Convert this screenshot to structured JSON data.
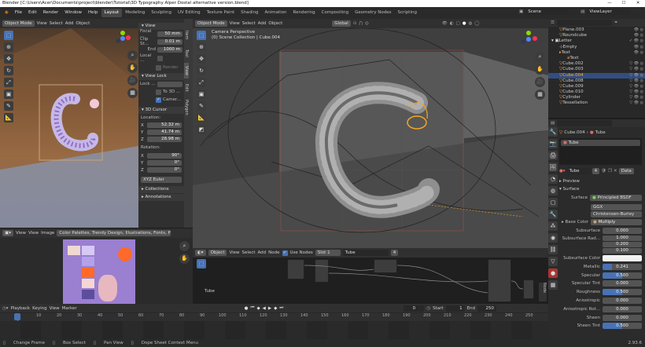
{
  "title": "Blender [C:\\Users\\Acer\\Documents\\project\\blender\\Tutorial\\3D Typography Alper Dostal alternative version.blend]",
  "window_controls": [
    "—",
    "☐",
    "✕"
  ],
  "menu": [
    "File",
    "Edit",
    "Render",
    "Window",
    "Help"
  ],
  "workspaces": [
    "Layout",
    "Modeling",
    "Sculpting",
    "UV Editing",
    "Texture Paint",
    "Shading",
    "Animation",
    "Rendering",
    "Compositing",
    "Geometry Nodes",
    "Scripting"
  ],
  "active_workspace": "Layout",
  "scene": "Scene",
  "view_layer": "ViewLayer",
  "left_viewport": {
    "mode": "Object Mode",
    "menus": [
      "View",
      "Select",
      "Add",
      "Object"
    ]
  },
  "n_panel": {
    "view_title": "View",
    "focal_label": "Focal ...",
    "focal_value": "50 mm",
    "clip_label": "Clip St...",
    "clip_value": "0.01 m",
    "end_label": "End",
    "end_value": "1000 m",
    "local_label": "Local ...",
    "render_label": "Render",
    "view_lock_title": "View Lock",
    "lock_label": "Lock ...",
    "lock_to_label": "To 3D ...",
    "camera_label": "Camer...",
    "cursor_title": "3D Cursor",
    "location_label": "Location:",
    "loc": [
      {
        "a": "X",
        "v": "52.32 m"
      },
      {
        "a": "Y",
        "v": "41.74 m"
      },
      {
        "a": "Z",
        "v": "28.98 m"
      }
    ],
    "rotation_label": "Rotation:",
    "rot": [
      {
        "a": "X",
        "v": "90°"
      },
      {
        "a": "Y",
        "v": "0°"
      },
      {
        "a": "Z",
        "v": "0°"
      }
    ],
    "rot_mode": "XYZ Euler",
    "collections_title": "Collections",
    "annotations_title": "Annotations",
    "tabs": [
      "Item",
      "Tool",
      "View",
      "Edit",
      "Polygon"
    ]
  },
  "main_viewport": {
    "mode": "Object Mode",
    "menus": [
      "View",
      "Select",
      "Add",
      "Object"
    ],
    "camera_label": "Camera Perspective",
    "collection_label": "(0) Scene Collection | Cube.004",
    "transform": "Global"
  },
  "image_editor": {
    "menus": [
      "View",
      "View",
      "Image"
    ],
    "image_name": "Color Palettes, Trendy Design, Illustrations, Fonts, Procreate"
  },
  "node_editor": {
    "object": "Object",
    "menus": [
      "View",
      "Select",
      "Add",
      "Node"
    ],
    "use_nodes": "Use Nodes",
    "slot": "Slot 1",
    "material": "Tube",
    "users": "4",
    "frame_label": "Tube"
  },
  "outliner": {
    "search": "",
    "items": [
      {
        "name": "Plane.003",
        "indent": 1,
        "sel": false
      },
      {
        "name": "Roundcube",
        "indent": 1,
        "sel": false
      },
      {
        "name": "Letter",
        "indent": 0,
        "sel": false
      },
      {
        "name": "Empty",
        "indent": 1,
        "sel": false
      },
      {
        "name": "Text",
        "indent": 1,
        "sel": false
      },
      {
        "name": "Text",
        "indent": 2,
        "sel": false
      },
      {
        "name": "Cube.002",
        "indent": 1,
        "sel": false
      },
      {
        "name": "Cube.003",
        "indent": 1,
        "sel": false
      },
      {
        "name": "Cube.004",
        "indent": 1,
        "sel": true
      },
      {
        "name": "Cube.008",
        "indent": 1,
        "sel": false
      },
      {
        "name": "Cube.009",
        "indent": 1,
        "sel": false
      },
      {
        "name": "Cube.010",
        "indent": 1,
        "sel": false
      },
      {
        "name": "Cylinder",
        "indent": 1,
        "sel": false
      },
      {
        "name": "Tessellation",
        "indent": 1,
        "sel": false
      }
    ]
  },
  "properties": {
    "object": "Cube.004",
    "material": "Tube",
    "slot_material": "Tube",
    "users": "4",
    "data": "Data",
    "preview": "Preview",
    "surface_title": "Surface",
    "surface_label": "Surface",
    "shader": "Principled BSDF",
    "distribution": "GGX",
    "subsurface_method": "Christensen-Burley",
    "base_color_label": "Base Color",
    "base_color_value": "Multiply",
    "rows": [
      {
        "l": "Subsurface",
        "v": "0.000",
        "blue": false
      },
      {
        "l": "Subsurface Rad...",
        "v": "1.000",
        "blue": false
      },
      {
        "l": "",
        "v": "0.200",
        "blue": false
      },
      {
        "l": "",
        "v": "0.100",
        "blue": false
      },
      {
        "l": "Subsurface Color",
        "v": "",
        "blue": false
      },
      {
        "l": "Metallic",
        "v": "0.241",
        "blue": true
      },
      {
        "l": "Specular",
        "v": "0.500",
        "blue": true
      },
      {
        "l": "Specular Tint",
        "v": "0.000",
        "blue": false
      },
      {
        "l": "Roughness",
        "v": "0.500",
        "blue": true
      },
      {
        "l": "Anisotropic",
        "v": "0.000",
        "blue": false
      },
      {
        "l": "Anisotropic Rot...",
        "v": "0.000",
        "blue": false
      },
      {
        "l": "Sheen",
        "v": "0.000",
        "blue": false
      },
      {
        "l": "Sheen Tint",
        "v": "0.500",
        "blue": true
      }
    ]
  },
  "timeline": {
    "menus": [
      "Playback",
      "Keying",
      "View",
      "Marker"
    ],
    "current": "0",
    "start_label": "Start",
    "start": "1",
    "end_label": "End",
    "end": "250",
    "ticks": [
      "0",
      "10",
      "20",
      "30",
      "40",
      "50",
      "60",
      "70",
      "80",
      "90",
      "100",
      "110",
      "120",
      "130",
      "140",
      "150",
      "160",
      "170",
      "180",
      "190",
      "200",
      "210",
      "220",
      "230",
      "240",
      "250"
    ]
  },
  "status": {
    "items": [
      "Change Frame",
      "Box Select",
      "Pan View",
      "Dope Sheet Context Menu"
    ],
    "version": "2.93.6"
  }
}
